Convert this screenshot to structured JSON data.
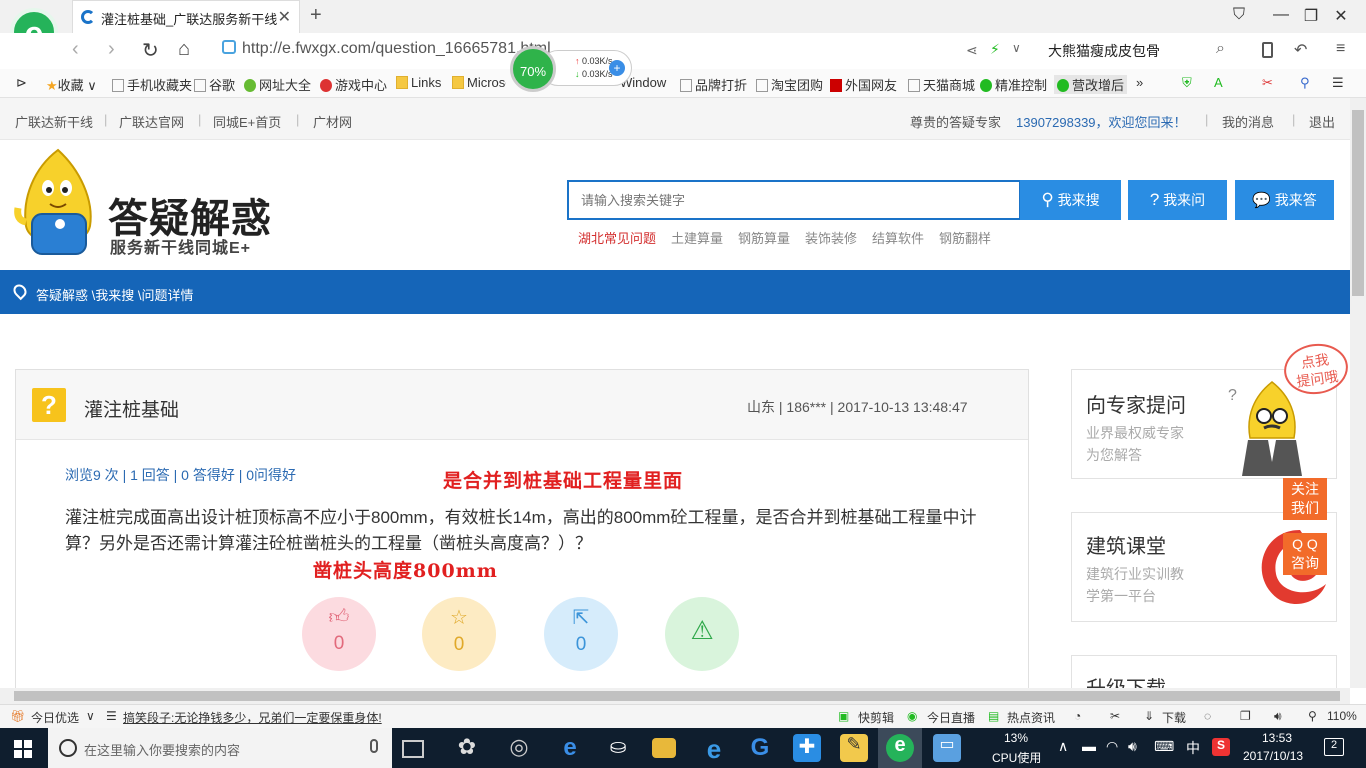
{
  "browser": {
    "tab_title": "灌注桩基础_广联达服务新干线",
    "url": "http://e.fwxgx.com/question_16665781.html",
    "right_search": "大熊猫瘦成皮包骨",
    "speed": {
      "percent": "70%",
      "up": "0.03K/s",
      "down": "0.03K/s"
    },
    "bookmarks": [
      "收藏",
      "手机收藏夹",
      "谷歌",
      "网址大全",
      "游戏中心",
      "Links",
      "Microsoft Store",
      "Window",
      "品牌打折",
      "淘宝团购",
      "外国网友",
      "天猫商城",
      "精准控制",
      "营改增后"
    ]
  },
  "site_top": {
    "left_links": [
      "广联达新干线",
      "广联达官网",
      "同城E+首页",
      "广材网"
    ],
    "greeting_prefix": "尊贵的答疑专家",
    "user_welcome": "13907298339，欢迎您回来！",
    "messages": "我的消息",
    "logout": "退出"
  },
  "header": {
    "brand": "答疑解惑",
    "brand_sub": "服务新干线同城E+",
    "search_placeholder": "请输入搜索关键字",
    "buttons": {
      "search": "我来搜",
      "ask": "我来问",
      "answer": "我来答"
    },
    "hot_links": [
      "湖北常见问题",
      "土建算量",
      "钢筋算量",
      "装饰装修",
      "结算软件",
      "钢筋翻样"
    ]
  },
  "breadcrumb": "答疑解惑 \\我来搜 \\问题详情",
  "question": {
    "title": "灌注桩基础",
    "meta": "山东 | 186*** | 2017-10-13 13:48:47",
    "stats": "浏览9 次 | 1 回答 | 0 答得好 | 0问得好",
    "annotation_top": "是合并到桩基础工程量里面",
    "body": "灌注桩完成面高出设计桩顶标高不应小于800mm，有效桩长14m，高出的800mm砼工程量，是否合并到桩基础工程量中计算？另外是否还需计算灌注砼桩凿桩头的工程量（凿桩头高度高？）？",
    "annotation_bottom": "凿桩头高度800mm",
    "actions": {
      "like": "0",
      "favorite": "0",
      "share": "0"
    }
  },
  "sidebar": {
    "expert": {
      "title": "向专家提问",
      "sub1": "业界最权威专家",
      "sub2": "为您解答",
      "bubble1": "点我",
      "bubble2": "提问哦"
    },
    "course": {
      "title": "建筑课堂",
      "sub1": "建筑行业实训教",
      "sub2": "学第一平台"
    },
    "download": {
      "title": "升级下载"
    },
    "float_follow": [
      "关注",
      "我们"
    ],
    "float_qq": [
      "Q Q",
      "咨询"
    ]
  },
  "statusbar": {
    "daily": "今日优选",
    "news": "搞笑段子:无论挣钱多少，兄弟们一定要保重身体!",
    "items": [
      "快剪辑",
      "今日直播",
      "热点资讯",
      "下载"
    ],
    "zoom": "110%"
  },
  "taskbar": {
    "search_placeholder": "在这里输入你要搜索的内容",
    "cpu_percent": "13%",
    "cpu_label": "CPU使用",
    "ime": "中",
    "time": "13:53",
    "date": "2017/10/13",
    "notifications": "2"
  },
  "colors": {
    "nav_blue": "#1565b8",
    "button_blue": "#2a8de3",
    "annotation_red": "#e12020",
    "link_blue": "#2b6ab2"
  }
}
